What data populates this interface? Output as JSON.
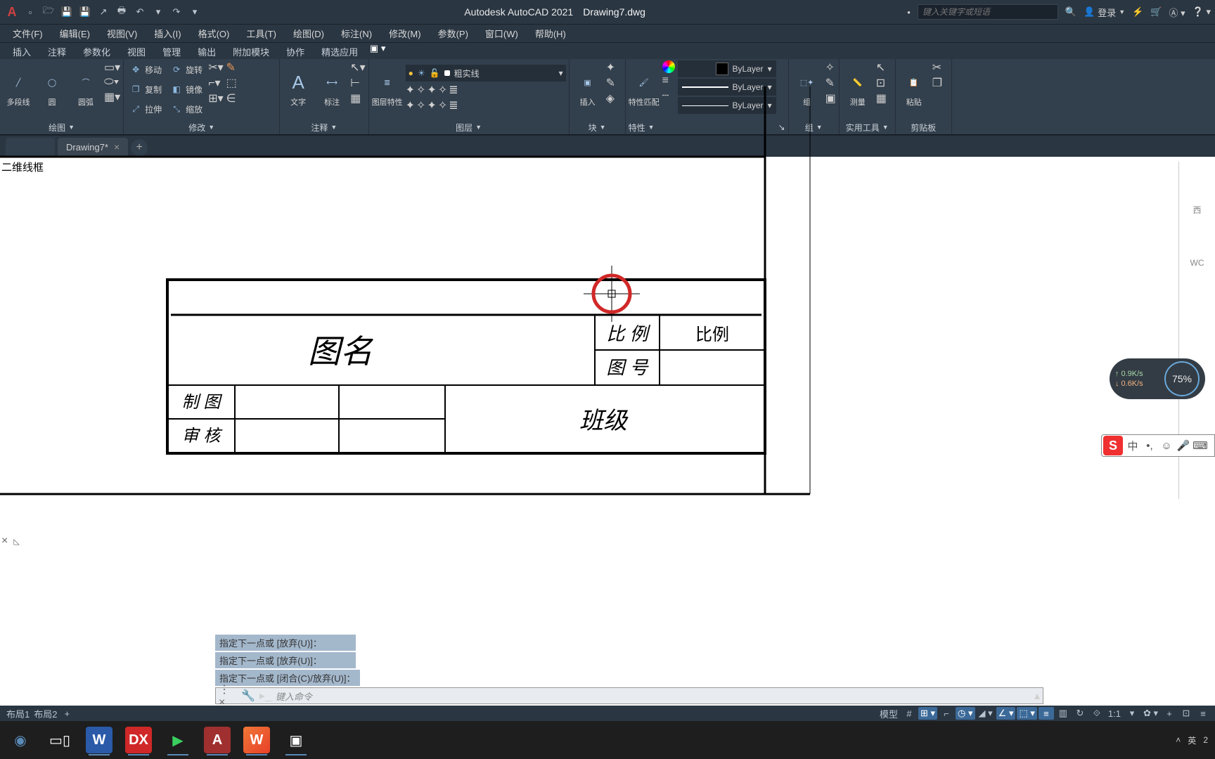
{
  "titlebar": {
    "app": "Autodesk AutoCAD 2021",
    "file": "Drawing7.dwg",
    "search_placeholder": "键入关键字或短语",
    "login": "登录"
  },
  "menu": [
    "文件(F)",
    "编辑(E)",
    "视图(V)",
    "插入(I)",
    "格式(O)",
    "工具(T)",
    "绘图(D)",
    "标注(N)",
    "修改(M)",
    "参数(P)",
    "窗口(W)",
    "帮助(H)"
  ],
  "ribbon_tabs": [
    "插入",
    "注释",
    "参数化",
    "视图",
    "管理",
    "输出",
    "附加模块",
    "协作",
    "精选应用"
  ],
  "ribbon": {
    "draw": {
      "label": "绘图",
      "polyline": "多段线",
      "circle": "圆",
      "arc": "圆弧"
    },
    "modify": {
      "label": "修改",
      "move": "移动",
      "rotate": "旋转",
      "copy": "复制",
      "mirror": "镜像",
      "stretch": "拉伸",
      "scale": "缩放"
    },
    "annot": {
      "label": "注释",
      "text": "文字",
      "dim": "标注"
    },
    "layer": {
      "label": "图层",
      "props": "图层特性",
      "current": "粗实线"
    },
    "block": {
      "label": "块",
      "insert": "插入"
    },
    "props": {
      "label": "特性",
      "match": "特性匹配",
      "bylayer": "ByLayer"
    },
    "group": {
      "label": "组",
      "g": "组"
    },
    "util": {
      "label": "实用工具",
      "measure": "测量"
    },
    "clip": {
      "label": "剪贴板",
      "paste": "粘贴"
    }
  },
  "drawtab": {
    "name": "Drawing7*",
    "plus": "+"
  },
  "viewport_label": "二维线框",
  "title_block": {
    "tuming": "图名",
    "bili": "比 例",
    "bilival": "比例",
    "tuhao": "图 号",
    "zhitu": "制 图",
    "shenhe": "审 核",
    "banji": "班级"
  },
  "speed": {
    "up": "0.9K/s",
    "down": "0.6K/s",
    "pct": "75%"
  },
  "ime": {
    "brand": "S",
    "zh": "中"
  },
  "cmd": {
    "h1": "指定下一点或 [放弃(U)]：",
    "h2": "指定下一点或 [放弃(U)]：",
    "h3": "指定下一点或 [闭合(C)/放弃(U)]：",
    "placeholder": "键入命令"
  },
  "layouts": {
    "l1": "布局1",
    "l2": "布局2",
    "plus": "+"
  },
  "status": {
    "model": "模型",
    "ratio": "1:1"
  },
  "rightpanel": {
    "v1": "西",
    "v2": "WC"
  },
  "tray": {
    "lang": "英",
    "time": "2"
  }
}
